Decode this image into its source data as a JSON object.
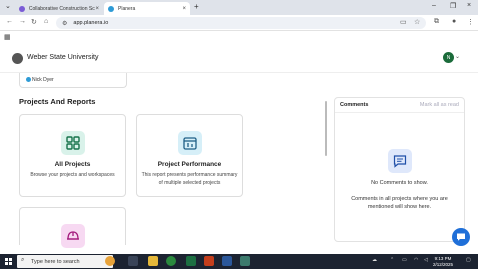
{
  "browser": {
    "tabs": [
      {
        "label": "Collaborative Construction Sch",
        "active": false
      },
      {
        "label": "Planera",
        "active": true
      }
    ],
    "new_tab": "+",
    "url": "app.planera.io"
  },
  "header": {
    "org_name": "Weber State University",
    "avatar_initial": "N"
  },
  "previous_card": {
    "person": "Nick Dyer"
  },
  "section": {
    "title": "Projects And Reports"
  },
  "cards": [
    {
      "title": "All Projects",
      "description": "Browse your projects and workspaces"
    },
    {
      "title": "Project Performance",
      "description": "This report presents performance summary of multiple selected projects"
    }
  ],
  "comments": {
    "title": "Comments",
    "mark_all": "Mark all as read",
    "empty_title": "No Comments to show.",
    "empty_hint": "Comments in all projects where you are mentioned will show here."
  },
  "taskbar": {
    "search_placeholder": "Type here to search",
    "time": "9:13 PM",
    "date": "2/12/2025"
  },
  "colors": {
    "accent": "#1f6fd8",
    "all_projects_icon_bg": "#d9f2ea",
    "performance_icon_bg": "#d6eff8",
    "third_icon_bg": "#f7d9f2"
  }
}
